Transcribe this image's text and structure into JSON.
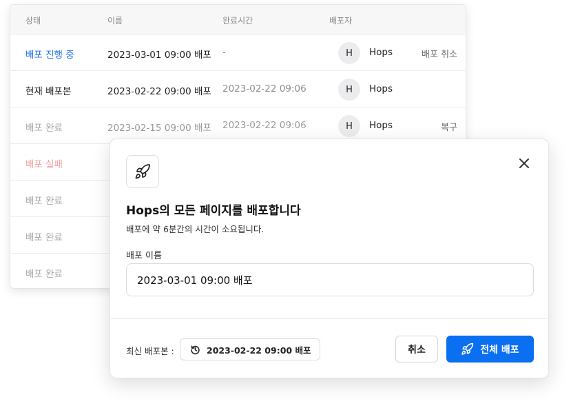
{
  "table": {
    "headers": {
      "status": "상태",
      "name": "이름",
      "completed_time": "완료시간",
      "deployer": "배포자"
    },
    "rows": [
      {
        "status": "배포 진행 중",
        "name": "2023-03-01 09:00 배포",
        "time": "-",
        "avatar": "H",
        "user": "Hops",
        "action": "배포 취소"
      },
      {
        "status": "현재 배포본",
        "name": "2023-02-22 09:00 배포",
        "time": "2023-02-22 09:06",
        "avatar": "H",
        "user": "Hops",
        "action": ""
      },
      {
        "status": "배포 완료",
        "name": "2023-02-15 09:00 배포",
        "time": "2023-02-22 09:06",
        "avatar": "H",
        "user": "Hops",
        "action": "복구"
      },
      {
        "status": "배포 실패",
        "name": "",
        "time": "",
        "avatar": "",
        "user": "",
        "action": ""
      },
      {
        "status": "배포 완료",
        "name": "",
        "time": "",
        "avatar": "",
        "user": "",
        "action": ""
      },
      {
        "status": "배포 완료",
        "name": "",
        "time": "",
        "avatar": "",
        "user": "",
        "action": ""
      },
      {
        "status": "배포 완료",
        "name": "",
        "time": "",
        "avatar": "",
        "user": "",
        "action": ""
      }
    ]
  },
  "modal": {
    "icon": "rocket-icon",
    "title": "Hops의 모든 페이지를 배포합니다",
    "description": "배포에 약 6분간의 시간이 소요됩니다.",
    "field_label": "배포 이름",
    "field_value": "2023-03-01 09:00 배포",
    "latest_label": "최신 배포본 :",
    "latest_value": "2023-02-22 09:00 배포",
    "cancel_label": "취소",
    "deploy_label": "전체 배포"
  },
  "colors": {
    "accent": "#0a6ff0",
    "in_progress": "#1f6fe5",
    "failed": "#f0a0a0",
    "muted": "#a8a8a8"
  }
}
